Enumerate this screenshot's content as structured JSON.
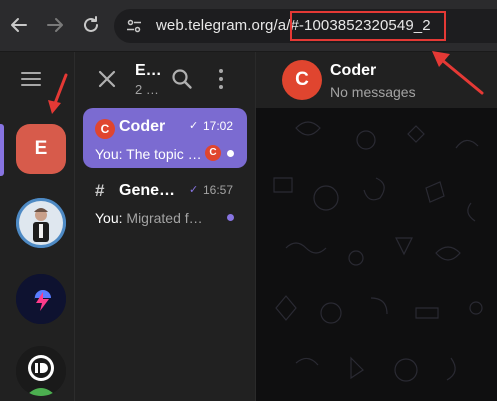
{
  "browser": {
    "url": "web.telegram.org/a/#-1003852320549_2",
    "back_icon": "arrow-left-icon",
    "forward_icon": "arrow-right-icon",
    "reload_icon": "reload-icon",
    "site_settings_icon": "tune-icon"
  },
  "rail": {
    "menu_icon": "hamburger-icon",
    "folders": [
      {
        "label": "E",
        "color": "#d75b4b",
        "active": true
      },
      {
        "label": "",
        "kind": "person-avatar"
      },
      {
        "label": "",
        "kind": "bolt-avatar"
      },
      {
        "label": "ID",
        "kind": "id-avatar"
      }
    ]
  },
  "chatlist": {
    "title": "E…",
    "subtitle": "2 …",
    "items": [
      {
        "avatar_letter": "C",
        "title": "Coder",
        "check": "✓",
        "time": "17:02",
        "sender": "You:",
        "preview": "The topic …",
        "badge_letter": "C",
        "active": true
      },
      {
        "avatar_symbol": "#",
        "title": "Gene…",
        "check": "✓",
        "time": "16:57",
        "sender": "You:",
        "preview": "Migrated f…",
        "active": false
      }
    ]
  },
  "chat": {
    "avatar_letter": "C",
    "name": "Coder",
    "status": "No messages"
  },
  "colors": {
    "accent": "#8774e1",
    "active_row": "#7b6bd1",
    "annotation_red": "#e53935",
    "avatar_red": "#e0452f"
  }
}
